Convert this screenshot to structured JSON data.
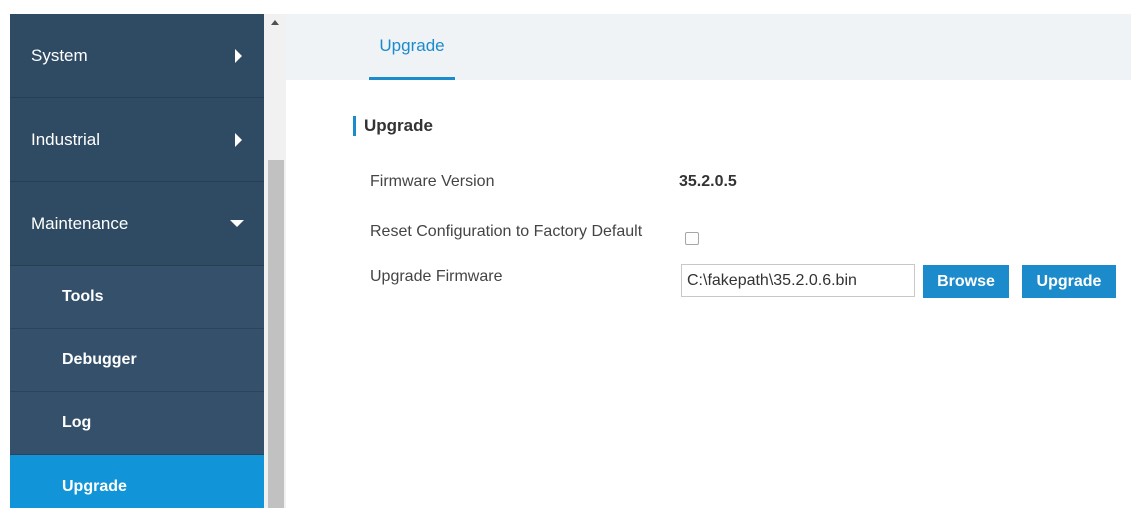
{
  "sidebar": {
    "items": [
      {
        "label": "System"
      },
      {
        "label": "Industrial"
      },
      {
        "label": "Maintenance"
      }
    ],
    "subitems": [
      {
        "label": "Tools"
      },
      {
        "label": "Debugger"
      },
      {
        "label": "Log"
      },
      {
        "label": "Upgrade"
      }
    ]
  },
  "tabs": [
    {
      "label": "Upgrade"
    }
  ],
  "section": {
    "title": "Upgrade"
  },
  "form": {
    "firmware_version_label": "Firmware Version",
    "firmware_version_value": "35.2.0.5",
    "reset_label": "Reset Configuration to Factory Default",
    "upgrade_firmware_label": "Upgrade Firmware",
    "file_value": "C:\\fakepath\\35.2.0.6.bin",
    "browse_label": "Browse",
    "upgrade_label": "Upgrade"
  },
  "colors": {
    "sidebar_bg": "#2f4b63",
    "active_item": "#1295d8",
    "accent": "#1c8bcb"
  }
}
